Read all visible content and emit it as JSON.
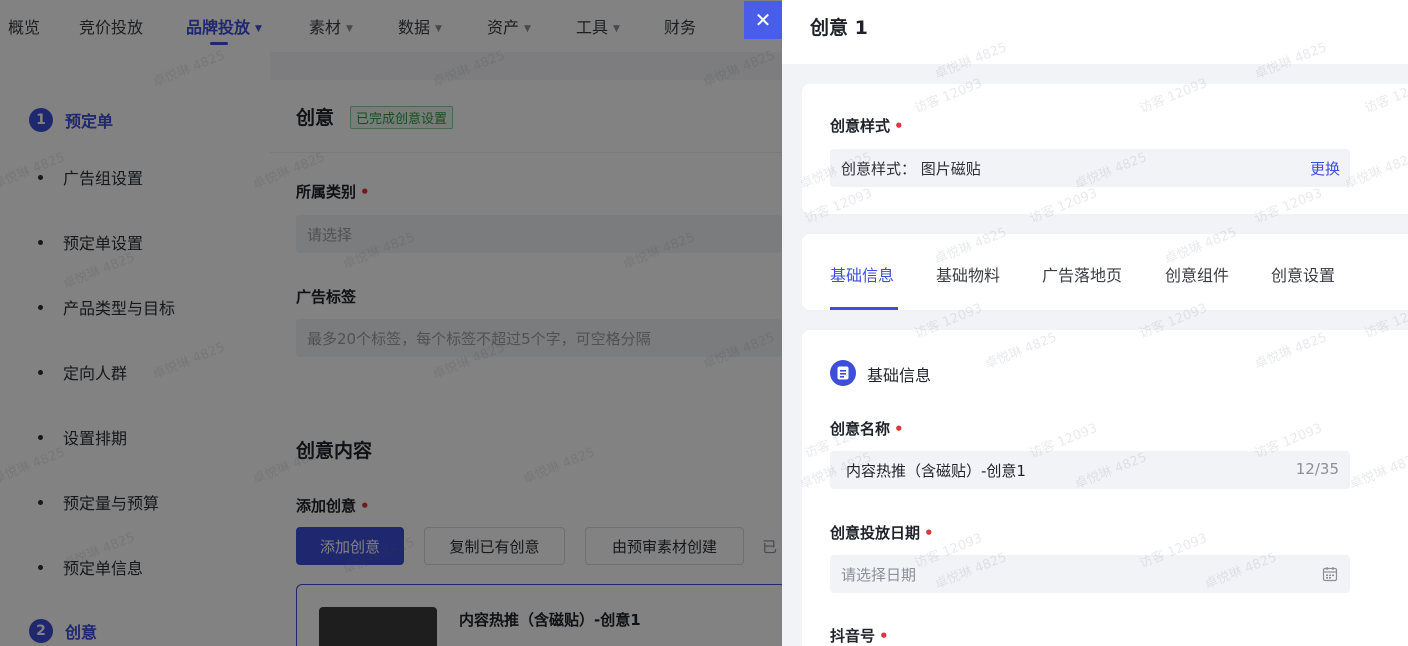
{
  "topnav": {
    "items": [
      {
        "label": "概览",
        "caret": false
      },
      {
        "label": "竞价投放",
        "caret": false
      },
      {
        "label": "品牌投放",
        "caret": true,
        "active": true
      },
      {
        "label": "素材",
        "caret": true
      },
      {
        "label": "数据",
        "caret": true
      },
      {
        "label": "资产",
        "caret": true
      },
      {
        "label": "工具",
        "caret": true
      },
      {
        "label": "财务",
        "caret": false
      }
    ],
    "caret_glyph": "▼"
  },
  "steps": {
    "step1": {
      "num": "1",
      "title": "预定单"
    },
    "step1_items": [
      "广告组设置",
      "预定单设置",
      "产品类型与目标",
      "定向人群",
      "设置排期",
      "预定量与预算",
      "预定单信息"
    ],
    "step2": {
      "num": "2",
      "title": "创意"
    }
  },
  "main": {
    "section_title": "创意",
    "done_badge": "已完成创意设置",
    "category_label": "所属类别",
    "category_placeholder": "请选择",
    "tags_label": "广告标签",
    "tags_placeholder": "最多20个标签，每个标签不超过5个字，可空格分隔",
    "content_title": "创意内容",
    "add_label": "添加创意",
    "buttons": {
      "add": "添加创意",
      "copy": "复制已有创意",
      "from_review": "由预审素材创建",
      "more": "已"
    },
    "creative_card_name": "内容热推（含磁贴）-创意1",
    "required_mark": "•"
  },
  "drawer": {
    "close_glyph": "✕",
    "title": "创意 1",
    "style_label": "创意样式",
    "style_value": "创意样式：  图片磁贴",
    "style_change": "更换",
    "tabs": [
      "基础信息",
      "基础物料",
      "广告落地页",
      "创意组件",
      "创意设置"
    ],
    "info_heading": "基础信息",
    "name_label": "创意名称",
    "name_value": "内容热推（含磁贴）-创意1",
    "name_counter": "12/35",
    "date_label": "创意投放日期",
    "date_placeholder": "请选择日期",
    "douyin_label": "抖音号"
  },
  "watermark": {
    "a": "卓悦琳 4825",
    "b": "访客 12093"
  },
  "colors": {
    "accent": "#3d4ed8",
    "required": "#e0363c",
    "success": "#2a9b3f"
  }
}
